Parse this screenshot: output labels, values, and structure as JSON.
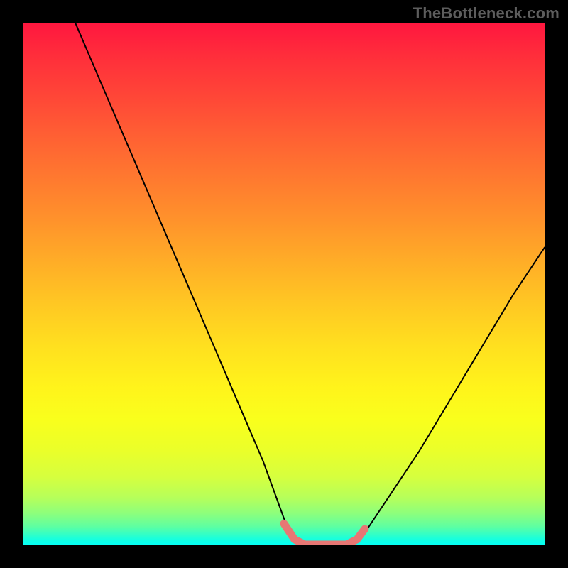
{
  "watermark": "TheBottleneck.com",
  "chart_data": {
    "type": "line",
    "title": "",
    "xlabel": "",
    "ylabel": "",
    "xlim": [
      0,
      100
    ],
    "ylim": [
      0,
      100
    ],
    "series": [
      {
        "name": "bottleneck-curve",
        "color": "#000000",
        "points": [
          {
            "x": 10,
            "y": 100
          },
          {
            "x": 16,
            "y": 86
          },
          {
            "x": 22,
            "y": 72
          },
          {
            "x": 28,
            "y": 58
          },
          {
            "x": 34,
            "y": 44
          },
          {
            "x": 40,
            "y": 30
          },
          {
            "x": 46,
            "y": 16
          },
          {
            "x": 50,
            "y": 5
          },
          {
            "x": 52,
            "y": 1
          },
          {
            "x": 54,
            "y": 0
          },
          {
            "x": 58,
            "y": 0
          },
          {
            "x": 62,
            "y": 0
          },
          {
            "x": 64,
            "y": 1
          },
          {
            "x": 66,
            "y": 3
          },
          {
            "x": 70,
            "y": 9
          },
          {
            "x": 76,
            "y": 18
          },
          {
            "x": 82,
            "y": 28
          },
          {
            "x": 88,
            "y": 38
          },
          {
            "x": 94,
            "y": 48
          },
          {
            "x": 100,
            "y": 57
          }
        ]
      },
      {
        "name": "optimal-highlight",
        "color": "#e77774",
        "points": [
          {
            "x": 50,
            "y": 4
          },
          {
            "x": 52,
            "y": 1
          },
          {
            "x": 54,
            "y": 0
          },
          {
            "x": 58,
            "y": 0
          },
          {
            "x": 62,
            "y": 0
          },
          {
            "x": 64,
            "y": 1
          },
          {
            "x": 65.5,
            "y": 3
          }
        ]
      }
    ],
    "gradient_stops": [
      {
        "pos": 0,
        "color": "#ff173f"
      },
      {
        "pos": 50,
        "color": "#ffc020"
      },
      {
        "pos": 80,
        "color": "#fdff1c"
      },
      {
        "pos": 100,
        "color": "#05fff0"
      }
    ]
  }
}
